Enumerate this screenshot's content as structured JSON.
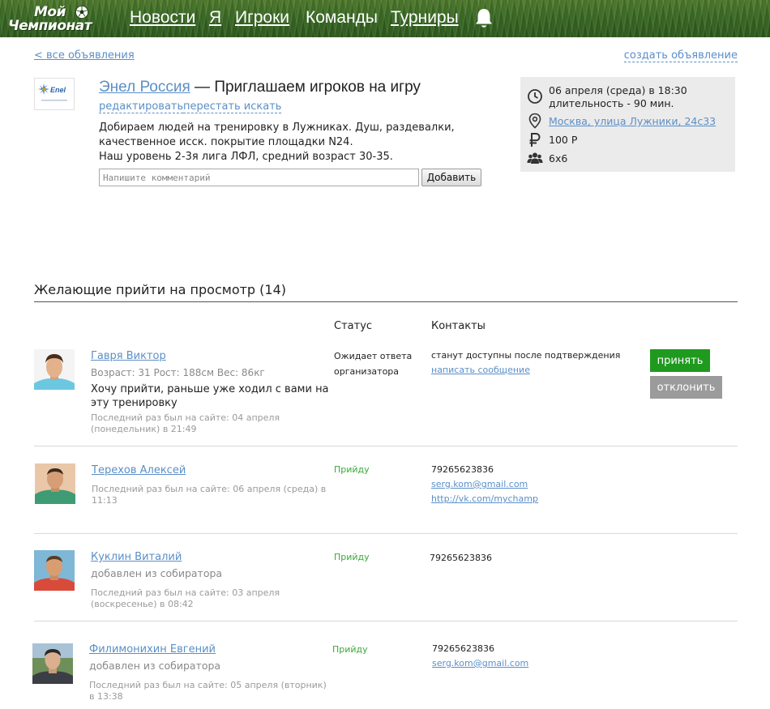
{
  "header": {
    "logo_line1": "Мой",
    "logo_line2": "Чемпионат",
    "nav": [
      "Новости",
      "Я",
      "Игроки",
      "Команды",
      "Турниры"
    ]
  },
  "links": {
    "back": "< все объявления",
    "create": "создать объявление"
  },
  "ad": {
    "logo_text": "Enel",
    "team": "Энел Россия",
    "title_sep": " — ",
    "title": "Приглашаем игроков на игру",
    "edit": "редактировать",
    "stop": "перестать искать",
    "desc_lines": [
      "Добираем людей на тренировку в Лужниках. Душ, раздевалки,",
      "качественное исск. покрытие площадки N24.",
      "Наш уровень 2-3я лига ЛФЛ, средний возраст 30-35."
    ],
    "comment_placeholder": "Напишите комментарий",
    "add_button": "Добавить"
  },
  "info": {
    "date_line1": "06 апреля (среда) в 18:30",
    "date_line2": "длительность - 90 мин.",
    "address": "Москва, улица Лужники, 24с33",
    "price": "100 Р",
    "format": "6х6",
    "icons": [
      "clock-icon",
      "location-pin-icon",
      "ruble-icon",
      "group-icon"
    ]
  },
  "section": {
    "title": "Желающие прийти на просмотр (14)",
    "col_status": "Статус",
    "col_contacts": "Контакты"
  },
  "candidates": [
    {
      "name": "Гавря Виктор",
      "meta": "Возраст: 31 Рост: 188см Вес: 86кг",
      "message": "Хочу прийти, раньше уже ходил с вами на эту тренировку",
      "last_seen": "Последний раз был на сайте: 04 апреля (понедельник) в 21:49",
      "status": "Ожидает ответа организатора",
      "contact_text": "станут доступны после подтверждения",
      "contact_link": "написать сообщение",
      "accept": "принять",
      "decline": "отклонить"
    },
    {
      "name": "Терехов Алексей",
      "last_seen": "Последний раз был на сайте: 06 апреля (среда) в 11:13",
      "status": "Прийду",
      "phone": "79265623836",
      "email": "serg.kom@gmail.com",
      "vk": "http://vk.com/mychamp"
    },
    {
      "name": "Куклин Виталий",
      "meta": "добавлен из собиратора",
      "last_seen": "Последний раз был на сайте: 03 апреля (воскресенье) в 08:42",
      "status": "Прийду",
      "phone": "79265623836"
    },
    {
      "name": "Филимонихин Евгений",
      "meta": "добавлен из собиратора",
      "last_seen": "Последний раз был на сайте: 05 апреля (вторник) в 13:38",
      "status": "Прийду",
      "phone": "79265623836",
      "email": "serg.kom@gmail.com"
    }
  ]
}
